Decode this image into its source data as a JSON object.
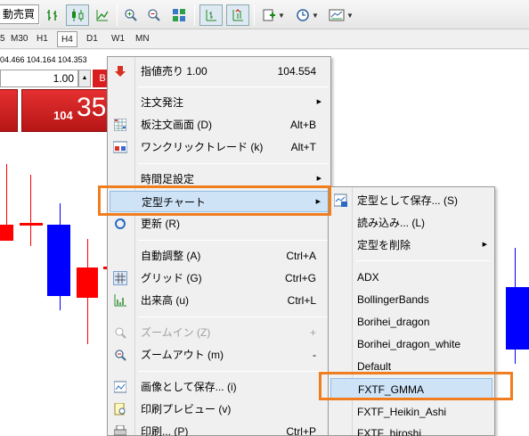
{
  "toolbar": {
    "left_text": "動売買",
    "icons": [
      "bar-chart-icon",
      "candlestick-icon",
      "line-chart-icon",
      "zoom-in-icon",
      "zoom-out-icon",
      "tile-windows-icon",
      "chart-shift-icon",
      "autoscroll-icon",
      "indicators-icon",
      "periods-icon",
      "templates-icon"
    ]
  },
  "timeframes": {
    "items": [
      "5",
      "M30",
      "H1",
      "H4",
      "D1",
      "W1",
      "MN"
    ],
    "active": "H4"
  },
  "chart": {
    "price_line": "04.466 104.164 104.353",
    "lot_value": "1.00",
    "ask_small": "104",
    "ask_big": "35",
    "colors": {
      "bull": "#0000ff",
      "bear": "#ff0000"
    }
  },
  "menu": {
    "items": [
      {
        "label": "指値売り 1.00",
        "shortcut": "104.554",
        "icon": "sell-limit-icon"
      },
      {
        "label": "注文発注",
        "icon": ""
      },
      {
        "label": "板注文画面 (D)",
        "shortcut": "Alt+B",
        "icon": "depth-of-market-icon"
      },
      {
        "label": "ワンクリックトレード (k)",
        "shortcut": "Alt+T",
        "icon": "one-click-trading-icon"
      },
      {
        "label": "時間足設定",
        "icon": ""
      },
      {
        "label": "定型チャート",
        "icon": "template-icon"
      },
      {
        "label": "更新 (R)",
        "icon": "refresh-icon"
      },
      {
        "label": "自動調整 (A)",
        "shortcut": "Ctrl+A",
        "icon": ""
      },
      {
        "label": "グリッド (G)",
        "shortcut": "Ctrl+G",
        "icon": "grid-icon"
      },
      {
        "label": "出来高 (u)",
        "shortcut": "Ctrl+L",
        "icon": "volumes-icon"
      },
      {
        "label": "ズームイン (Z)",
        "shortcut": "+",
        "icon": "zoom-in-icon"
      },
      {
        "label": "ズームアウト (m)",
        "shortcut": "-",
        "icon": "zoom-out-icon"
      },
      {
        "label": "画像として保存... (i)",
        "icon": "save-as-picture-icon"
      },
      {
        "label": "印刷プレビュー (v)",
        "icon": "print-preview-icon"
      },
      {
        "label": "印刷... (P)",
        "shortcut": "Ctrl+P",
        "icon": "print-icon"
      }
    ]
  },
  "submenu": {
    "items": [
      {
        "label": "定型として保存... (S)"
      },
      {
        "label": "読み込み... (L)"
      },
      {
        "label": "定型を削除"
      },
      {
        "label": "ADX"
      },
      {
        "label": "BollingerBands"
      },
      {
        "label": "Borihei_dragon"
      },
      {
        "label": "Borihei_dragon_white"
      },
      {
        "label": "Default"
      },
      {
        "label": "FXTF_GMMA"
      },
      {
        "label": "FXTF_Heikin_Ashi"
      },
      {
        "label": "FXTF_hiroshi"
      }
    ]
  },
  "highlight_color": "#f07d1e"
}
